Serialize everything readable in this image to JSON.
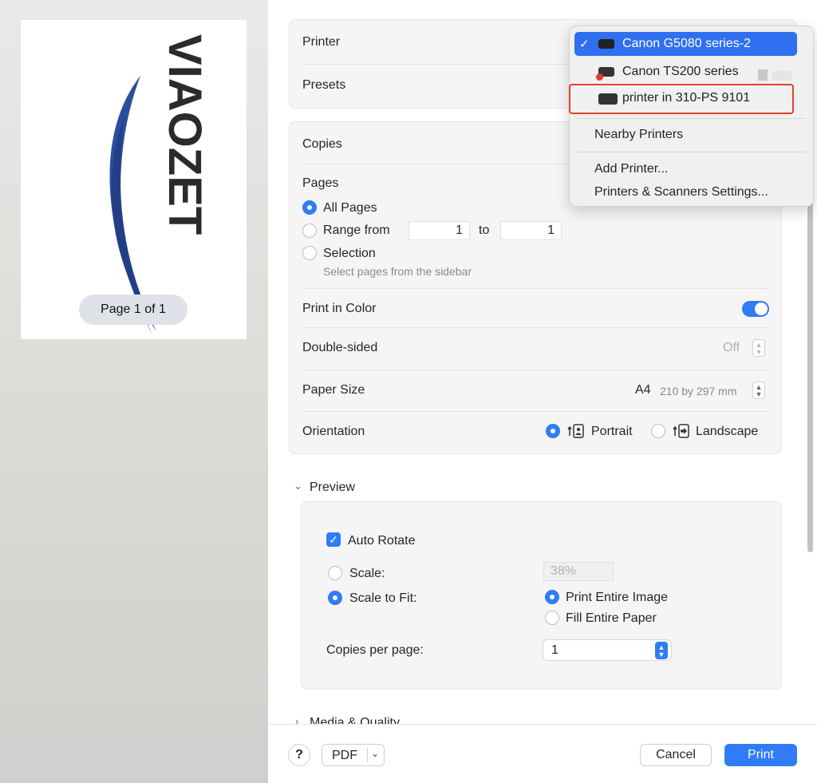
{
  "preview": {
    "page_indicator": "Page 1 of 1",
    "logo_text": "VIAOZET"
  },
  "printer": {
    "label": "Printer",
    "menu": {
      "items": [
        {
          "label": "Canon G5080 series-2",
          "checked": true
        },
        {
          "label": "Canon TS200 series",
          "status": "offline"
        },
        {
          "label": "printer in 310-PS 9101"
        }
      ],
      "nearby_label": "Nearby Printers",
      "add_label": "Add Printer...",
      "settings_label": "Printers & Scanners Settings..."
    }
  },
  "presets": {
    "label": "Presets"
  },
  "copies": {
    "label": "Copies"
  },
  "pages": {
    "label": "Pages",
    "all_label": "All Pages",
    "range_label": "Range from",
    "range_from": "1",
    "to_label": "to",
    "range_to": "1",
    "selection_label": "Selection",
    "selection_hint": "Select pages from the sidebar"
  },
  "print_in_color": {
    "label": "Print in Color",
    "value": true
  },
  "double_sided": {
    "label": "Double-sided",
    "value": "Off"
  },
  "paper_size": {
    "label": "Paper Size",
    "value": "A4",
    "detail": "210 by 297 mm"
  },
  "orientation": {
    "label": "Orientation",
    "portrait": "Portrait",
    "landscape": "Landscape",
    "selected": "Portrait"
  },
  "preview_section": {
    "title": "Preview",
    "auto_rotate": "Auto Rotate",
    "scale_label": "Scale:",
    "scale_value": "38%",
    "scale_to_fit": "Scale to Fit:",
    "print_entire": "Print Entire Image",
    "fill_entire": "Fill Entire Paper",
    "copies_per_page_label": "Copies per page:",
    "copies_per_page_value": "1"
  },
  "media_quality": {
    "title": "Media & Quality"
  },
  "footer": {
    "help": "?",
    "pdf": "PDF",
    "cancel": "Cancel",
    "print": "Print"
  },
  "colors": {
    "accent": "#2f7cf6",
    "highlight_box": "#e0432f"
  }
}
